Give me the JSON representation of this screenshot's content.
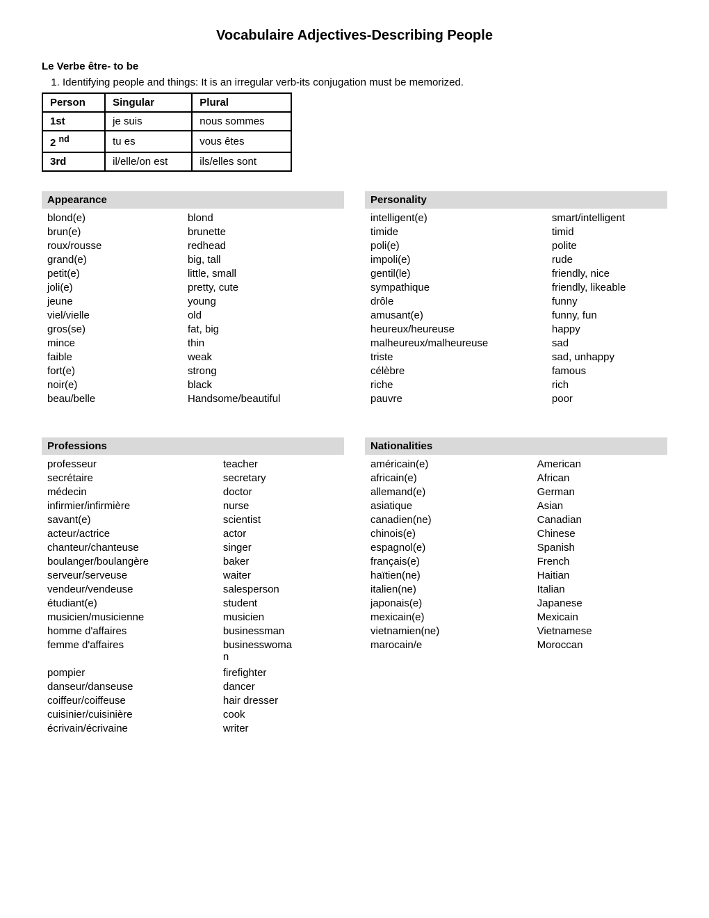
{
  "title": "Vocabulaire Adjectives-Describing People",
  "verbe_section": {
    "heading": "Le Verbe être- to be",
    "item1": "Identifying people and things:  It is an irregular verb-its conjugation must be memorized.",
    "table": {
      "headers": [
        "Person",
        "Singular",
        "Plural"
      ],
      "rows": [
        [
          "1st",
          "je suis",
          "nous sommes"
        ],
        [
          "2 nd",
          "tu es",
          "vous êtes"
        ],
        [
          "3rd",
          "il/elle/on est",
          "ils/elles sont"
        ]
      ]
    }
  },
  "appearance": {
    "header": "Appearance",
    "items": [
      [
        "blond(e)",
        "blond"
      ],
      [
        "brun(e)",
        "brunette"
      ],
      [
        "roux/rousse",
        "redhead"
      ],
      [
        "grand(e)",
        "big, tall"
      ],
      [
        "petit(e)",
        "little, small"
      ],
      [
        "joli(e)",
        "pretty, cute"
      ],
      [
        "jeune",
        "young"
      ],
      [
        "viel/vielle",
        "old"
      ],
      [
        "gros(se)",
        "fat, big"
      ],
      [
        "mince",
        "thin"
      ],
      [
        "faible",
        "weak"
      ],
      [
        "fort(e)",
        "strong"
      ],
      [
        "noir(e)",
        "black"
      ],
      [
        "beau/belle",
        "Handsome/beautiful"
      ]
    ]
  },
  "personality": {
    "header": "Personality",
    "items": [
      [
        "intelligent(e)",
        "smart/intelligent"
      ],
      [
        "timide",
        "timid"
      ],
      [
        "poli(e)",
        "polite"
      ],
      [
        "impoli(e)",
        "rude"
      ],
      [
        "gentil(le)",
        "friendly, nice"
      ],
      [
        "sympathique",
        "friendly, likeable"
      ],
      [
        "drôle",
        "funny"
      ],
      [
        "amusant(e)",
        "funny, fun"
      ],
      [
        "heureux/heureuse",
        "happy"
      ],
      [
        "malheureux/malheureuse",
        "sad"
      ],
      [
        "triste",
        "sad, unhappy"
      ],
      [
        "célèbre",
        "famous"
      ],
      [
        "riche",
        "rich"
      ],
      [
        "pauvre",
        "poor"
      ]
    ]
  },
  "professions": {
    "header": "Professions",
    "items": [
      [
        "professeur",
        "teacher"
      ],
      [
        "secrétaire",
        "secretary"
      ],
      [
        "médecin",
        "doctor"
      ],
      [
        "infirmier/infirmière",
        "nurse"
      ],
      [
        "savant(e)",
        "scientist"
      ],
      [
        "acteur/actrice",
        "actor"
      ],
      [
        "chanteur/chanteuse",
        "singer"
      ],
      [
        "boulanger/boulangère",
        "baker"
      ],
      [
        "serveur/serveuse",
        "waiter"
      ],
      [
        "vendeur/vendeuse",
        "salesperson"
      ],
      [
        "étudiant(e)",
        "student"
      ],
      [
        "musicien/musicienne",
        "musicien"
      ],
      [
        "homme d'affaires",
        "businessman"
      ],
      [
        "femme d'affaires",
        "businesswoman"
      ],
      [
        "",
        ""
      ],
      [
        "pompier",
        "firefighter"
      ],
      [
        "danseur/danseuse",
        "dancer"
      ],
      [
        "coiffeur/coiffeuse",
        "hair dresser"
      ],
      [
        "cuisinier/cuisinière",
        "cook"
      ],
      [
        "écrivain/écrivaine",
        "writer"
      ]
    ]
  },
  "nationalities": {
    "header": "Nationalities",
    "items": [
      [
        "américain(e)",
        "American"
      ],
      [
        "africain(e)",
        "African"
      ],
      [
        "allemand(e)",
        "German"
      ],
      [
        "asiatique",
        "Asian"
      ],
      [
        "canadien(ne)",
        "Canadian"
      ],
      [
        "chinois(e)",
        "Chinese"
      ],
      [
        "espagnol(e)",
        "Spanish"
      ],
      [
        "français(e)",
        "French"
      ],
      [
        "haïtien(ne)",
        "Haitian"
      ],
      [
        "italien(ne)",
        "Italian"
      ],
      [
        "japonais(e)",
        "Japanese"
      ],
      [
        "mexicain(e)",
        "Mexicain"
      ],
      [
        "vietnamien(ne)",
        "Vietnamese"
      ],
      [
        "marocain/e",
        "Moroccan"
      ]
    ]
  }
}
